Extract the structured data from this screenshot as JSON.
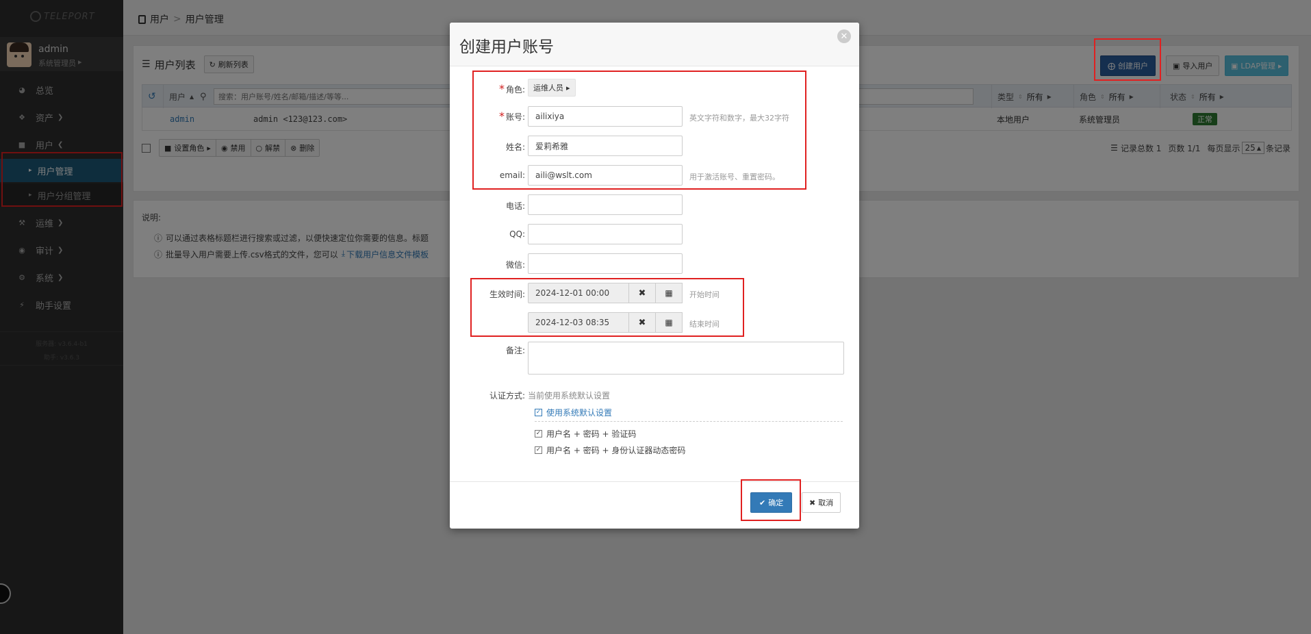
{
  "app": {
    "logo_text": "TELEPORT"
  },
  "user": {
    "name": "admin",
    "role": "系统管理员"
  },
  "nav": {
    "items": [
      {
        "label": "总览",
        "icon": "dashboard-icon"
      },
      {
        "label": "资产",
        "icon": "cubes-icon"
      },
      {
        "label": "用户",
        "icon": "user-icon"
      },
      {
        "label": "运维",
        "icon": "wrench-icon"
      },
      {
        "label": "审计",
        "icon": "eye-icon"
      },
      {
        "label": "系统",
        "icon": "gear-icon"
      },
      {
        "label": "助手设置",
        "icon": "bolt-icon"
      }
    ],
    "sub_items": [
      "用户管理",
      "用户分组管理"
    ],
    "version_server": "服务器: v3.6.4-b1",
    "version_assist": "助手: v3.6.3"
  },
  "breadcrumb": {
    "root": "用户",
    "current": "用户管理"
  },
  "list": {
    "title": "用户列表",
    "refresh_label": "刷新列表",
    "create_label": "创建用户",
    "import_label": "导入用户",
    "ldap_label": "LDAP管理",
    "search_placeholder": "搜索：用户账号/姓名/邮箱/描述/等等...",
    "columns": {
      "user": "用户",
      "type": "类型",
      "type_filter": "所有",
      "role": "角色",
      "role_filter": "所有",
      "status": "状态",
      "status_filter": "所有"
    },
    "rows": [
      {
        "account": "admin",
        "name_email": "admin <123@123.com>",
        "type": "本地用户",
        "role": "系统管理员",
        "status": "正常"
      }
    ],
    "actions": {
      "set_role": "设置角色",
      "disable": "禁用",
      "unlock": "解禁",
      "delete": "删除"
    },
    "pagination": {
      "total": "记录总数 1",
      "pages": "页数 1/1",
      "per_page_label": "每页显示",
      "per_page": "25",
      "suffix": "条记录"
    }
  },
  "notes": {
    "title": "说明:",
    "line1": "可以通过表格标题栏进行搜索或过滤，以便快速定位你需要的信息。标题",
    "line2": "批量导入用户需要上传.csv格式的文件，您可以",
    "download_link": "下载用户信息文件模板"
  },
  "modal": {
    "title": "创建用户账号",
    "role_label": "角色:",
    "role_value": "运维人员",
    "account_label": "账号:",
    "account_value": "ailixiya",
    "account_hint": "英文字符和数字，最大32字符",
    "name_label": "姓名:",
    "name_value": "爱莉希雅",
    "email_label": "email:",
    "email_value": "aili@wslt.com",
    "email_hint": "用于激活账号、重置密码。",
    "phone_label": "电话:",
    "qq_label": "QQ:",
    "wechat_label": "微信:",
    "valid_label": "生效时间:",
    "start_value": "2024-12-01 00:00",
    "start_hint": "开始时间",
    "end_value": "2024-12-03 08:35",
    "end_hint": "结束时间",
    "remark_label": "备注:",
    "auth_label": "认证方式:",
    "auth_current": "当前使用系统默认设置",
    "auth_default": "使用系统默认设置",
    "auth_opt1": "用户名 + 密码 + 验证码",
    "auth_opt2": "用户名 + 密码 + 身份认证器动态密码",
    "ok_label": "确定",
    "cancel_label": "取消"
  },
  "colors": {
    "sidebar_bg": "#2f2f2f",
    "active_nav": "#1d5b7a",
    "primary": "#337ab7",
    "create_btn": "#2a5f9e",
    "ldap_btn": "#5bc0de",
    "status_ok": "#2e7d32",
    "highlight": "#e02020"
  }
}
